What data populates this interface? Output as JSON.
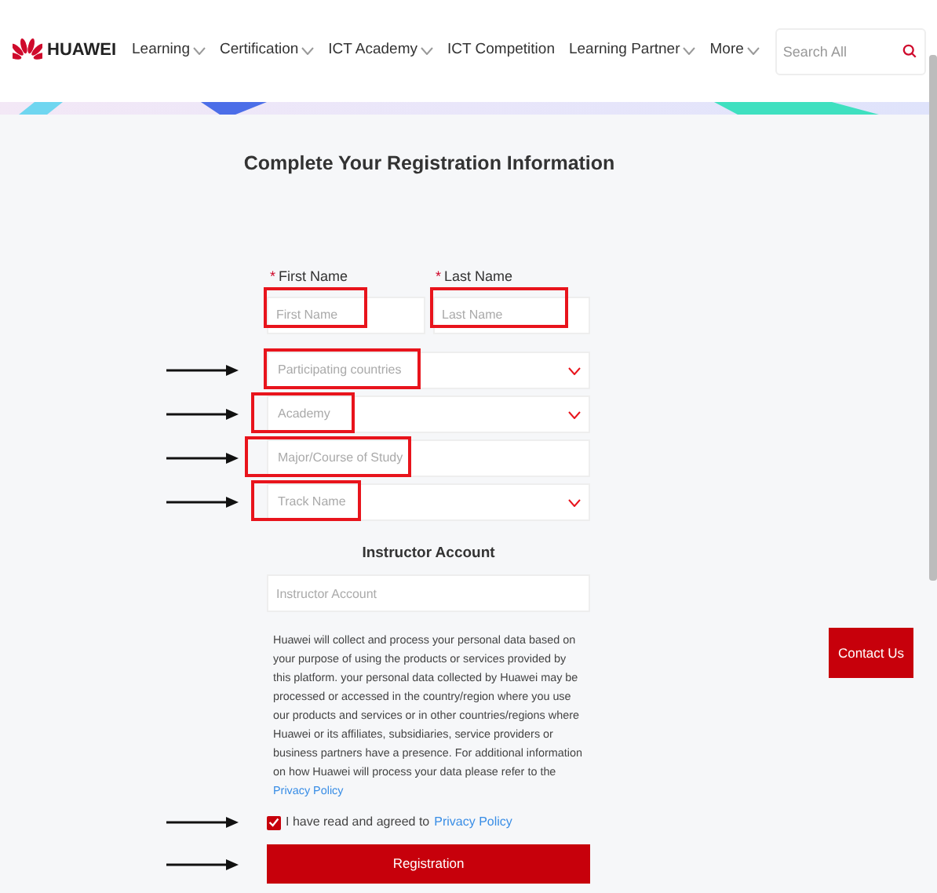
{
  "header": {
    "logo_text": "HUAWEI",
    "nav": [
      {
        "label": "Learning",
        "dropdown": true
      },
      {
        "label": "Certification",
        "dropdown": true
      },
      {
        "label": "ICT Academy",
        "dropdown": true
      },
      {
        "label": "ICT Competition",
        "dropdown": false
      },
      {
        "label": "Learning Partner",
        "dropdown": true
      },
      {
        "label": "More",
        "dropdown": true
      }
    ],
    "search": {
      "placeholder": "Search All"
    }
  },
  "form": {
    "title": "Complete Your Registration Information",
    "name_fields": [
      {
        "label": "First Name",
        "required_mark": "*",
        "placeholder": "First Name",
        "highlighted": true
      },
      {
        "label": "Last Name",
        "required_mark": "*",
        "placeholder": "Last Name",
        "highlighted": true
      }
    ],
    "fields": [
      {
        "kind": "select",
        "placeholder": "Participating countries",
        "highlighted": true,
        "arrow": true
      },
      {
        "kind": "select",
        "placeholder": "Academy",
        "highlighted": true,
        "arrow": true
      },
      {
        "kind": "text",
        "placeholder": "Major/Course of Study",
        "highlighted": true,
        "arrow": true
      },
      {
        "kind": "select",
        "placeholder": "Track Name",
        "highlighted": true,
        "arrow": true
      }
    ],
    "instructor": {
      "heading": "Instructor Account",
      "placeholder": "Instructor Account"
    },
    "notice": {
      "text": "Huawei will collect and process your personal data based on your purpose of using the products or services provided by this platform. your personal data collected by Huawei may be processed or accessed in the country/region where you use our products and services or in other countries/regions where Huawei or its affiliates, subsidiaries, service providers or business partners have a presence. For additional information on how Huawei will process your data please refer to the",
      "link": "Privacy Policy"
    },
    "agree": {
      "checked": true,
      "text": "I have read and agreed to",
      "link": "Privacy Policy",
      "arrow": true
    },
    "submit": {
      "label": "Registration",
      "arrow": true
    }
  },
  "contact_button": "Contact Us"
}
